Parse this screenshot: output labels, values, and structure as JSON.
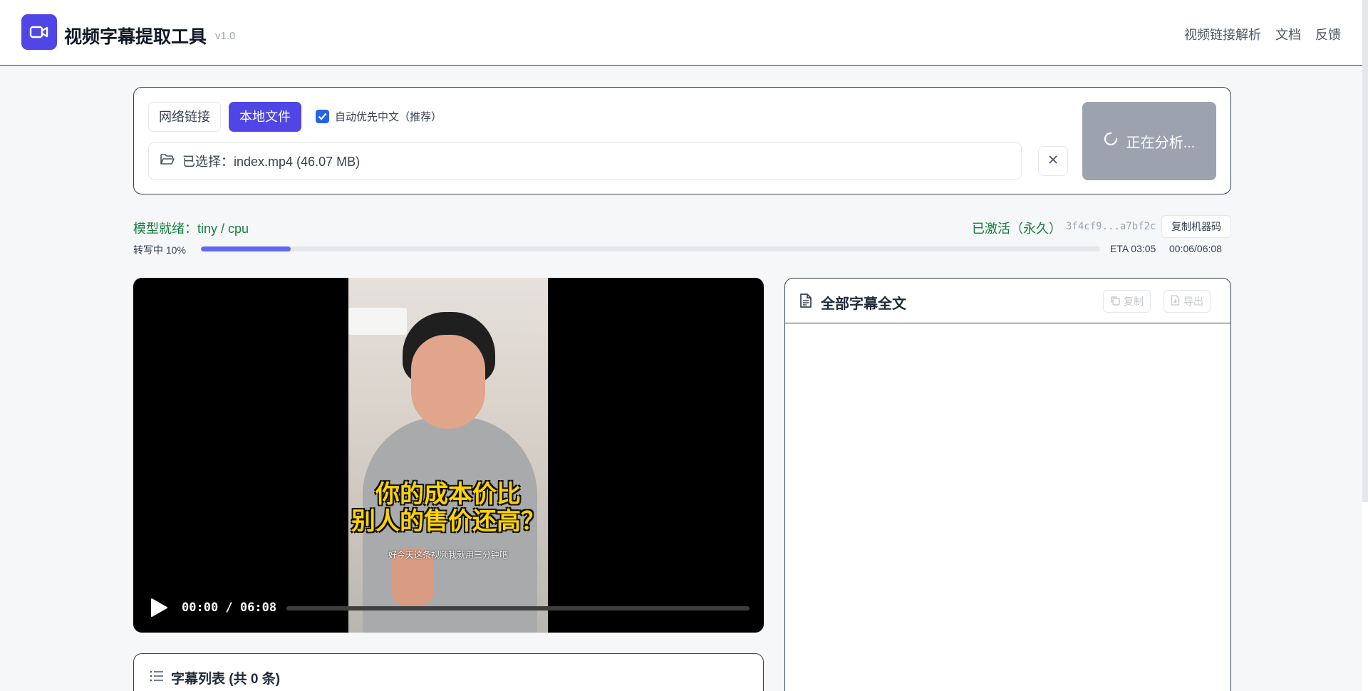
{
  "header": {
    "title": "视频字幕提取工具",
    "version": "v1.0",
    "nav": [
      "视频链接解析",
      "文档",
      "反馈"
    ]
  },
  "input": {
    "tabs": [
      {
        "label": "网络链接",
        "active": false
      },
      {
        "label": "本地文件",
        "active": true
      }
    ],
    "auto_chinese": {
      "label": "自动优先中文（推荐）",
      "checked": true
    },
    "file_text": "已选择：index.mp4 (46.07 MB)",
    "analyze_label": "正在分析..."
  },
  "status": {
    "model": "模型就绪：tiny / cpu",
    "activation": "已激活（永久）",
    "machine_code": "3f4cf9...a7bf2c",
    "copy_machine_label": "复制机器码",
    "progress_label": "转写中 10%",
    "progress_percent": 10,
    "eta": "ETA 03:05",
    "time_progress": "00:06/06:08"
  },
  "video": {
    "burned_subtitle": [
      "你的成本价比",
      "别人的售价还高？"
    ],
    "speech_subtitle": "好今天这条视频我就用三分钟吧",
    "time": "00:00 / 06:08"
  },
  "subtitle_list": {
    "title": "字幕列表 (共 0 条)"
  },
  "fulltext": {
    "title": "全部字幕全文",
    "copy_label": "复制",
    "export_label": "导出"
  },
  "colors": {
    "accent": "#4f46e5",
    "success": "#15803d",
    "disabled": "#9ca3af"
  }
}
